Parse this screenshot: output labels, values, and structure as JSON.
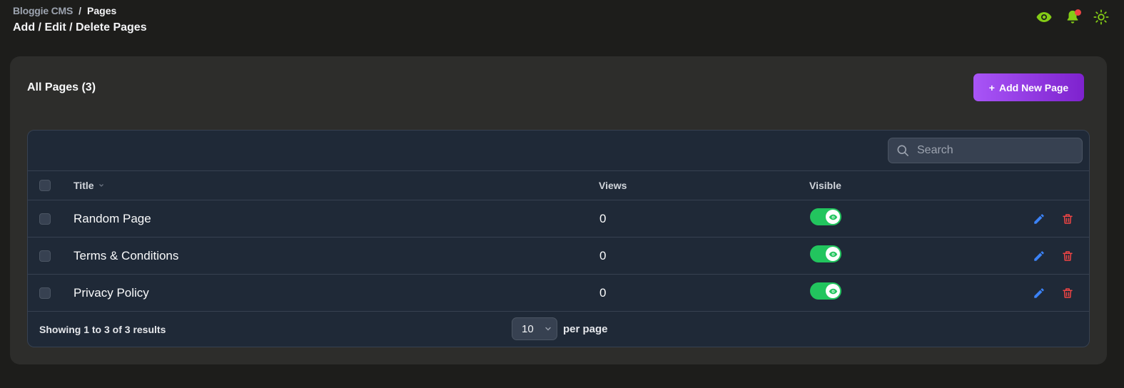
{
  "breadcrumb": {
    "root": "Bloggie CMS",
    "separator": "/",
    "current": "Pages"
  },
  "page_title": "Add / Edit / Delete Pages",
  "top_icons": [
    "eye-icon",
    "bell-icon",
    "sun-icon"
  ],
  "colors": {
    "accent_green": "#84cc16",
    "toggle_on": "#22c55e",
    "purple_start": "#a855f7",
    "purple_end": "#7e22ce",
    "danger": "#ef4444",
    "edit": "#3b82f6"
  },
  "card": {
    "title": "All Pages (3)",
    "add_button": "Add New Page",
    "add_button_icon": "+"
  },
  "search": {
    "placeholder": "Search"
  },
  "table": {
    "headers": {
      "title": "Title",
      "views": "Views",
      "visible": "Visible"
    },
    "rows": [
      {
        "title": "Random Page",
        "views": "0",
        "visible": true
      },
      {
        "title": "Terms & Conditions",
        "views": "0",
        "visible": true
      },
      {
        "title": "Privacy Policy",
        "views": "0",
        "visible": true
      }
    ]
  },
  "footer": {
    "showing": "Showing 1 to 3 of 3 results",
    "per_page_value": "10",
    "per_page_label": "per page"
  }
}
